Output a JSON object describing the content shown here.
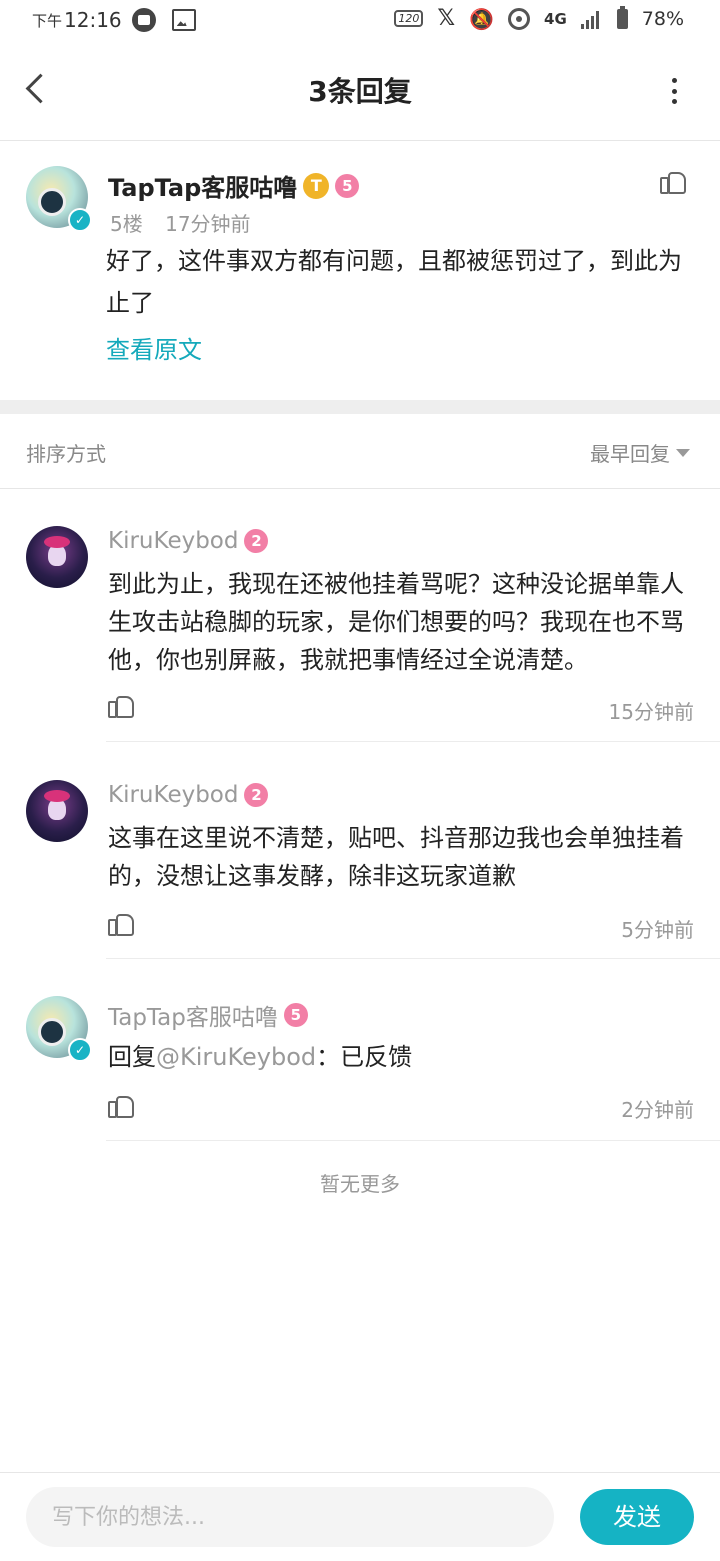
{
  "status_bar": {
    "ampm": "下午",
    "time": "12:16",
    "hz": "120",
    "network": "4G",
    "battery": "78%"
  },
  "header": {
    "title": "3条回复"
  },
  "original_post": {
    "author": "TapTap客服咕噜",
    "badge_t": "T",
    "level": "5",
    "floor": "5楼",
    "time": "17分钟前",
    "text": "好了，这件事双方都有问题，且都被惩罚过了，到此为止了",
    "view_original": "查看原文"
  },
  "sort": {
    "label": "排序方式",
    "value": "最早回复"
  },
  "replies": [
    {
      "author": "KiruKeybod",
      "level": "2",
      "text": "到此为止，我现在还被他挂着骂呢？这种没论据单靠人生攻击站稳脚的玩家，是你们想要的吗？我现在也不骂他，你也别屏蔽，我就把事情经过全说清楚。",
      "time": "15分钟前"
    },
    {
      "author": "KiruKeybod",
      "level": "2",
      "text": "这事在这里说不清楚，贴吧、抖音那边我也会单独挂着的，没想让这事发酵，除非这玩家道歉",
      "time": "5分钟前"
    },
    {
      "author": "TapTap客服咕噜",
      "level": "5",
      "reply_prefix": "回复",
      "mention": "@KiruKeybod",
      "text": "：已反馈",
      "time": "2分钟前"
    }
  ],
  "footer_note": "暂无更多",
  "composer": {
    "placeholder": "写下你的想法...",
    "send_label": "发送"
  },
  "colors": {
    "accent": "#15b3c4",
    "link": "#14a9bb",
    "level_badge": "#f27fa6",
    "t_badge": "#f0b429"
  }
}
